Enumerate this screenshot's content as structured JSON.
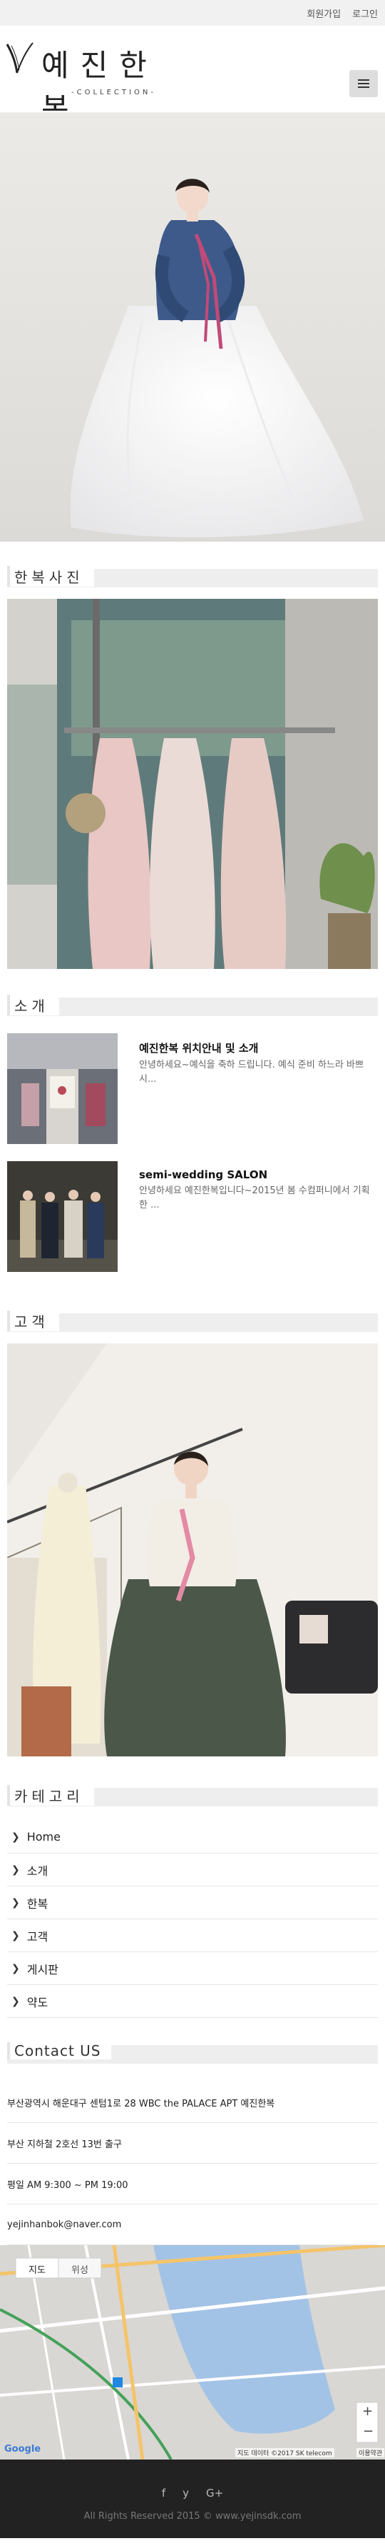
{
  "topbar": {
    "signup": "회원가입",
    "login": "로그인"
  },
  "logo": {
    "title": "예진한복",
    "subtitle": "-COLLECTION-"
  },
  "sections": {
    "photos": "한복사진",
    "intro": "소개",
    "customers": "고객",
    "category": "카테고리",
    "contact": "Contact US"
  },
  "news": [
    {
      "title": "예진한복 위치안내 및 소개",
      "summary": "안녕하세요~예식을 축하 드립니다. 예식 준비 하느라 바쁘시..."
    },
    {
      "title": "semi-wedding SALON",
      "summary": "안녕하세요 예진한복입니다~2015년 봄 수컴퍼니에서 기획한 ..."
    }
  ],
  "categories": [
    "Home",
    "소개",
    "한복",
    "고객",
    "게시판",
    "약도"
  ],
  "contact": {
    "address": "부산광역시 해운대구 센텀1로 28 WBC the PALACE APT 예진한복",
    "subway": "부산 지하철 2호선 13번 출구",
    "hours": "평일 AM 9:300 ~ PM 19:00",
    "email": "yejinhanbok@naver.com"
  },
  "map": {
    "labels": [
      "지도",
      "위성",
      "Google",
      "지도 데이터 ©2017 SK telecom",
      "이용약관"
    ],
    "zoom_in": "+",
    "zoom_out": "−"
  },
  "footer": {
    "social": [
      "f",
      "y",
      "G+"
    ],
    "copyright": "All Rights Reserved 2015 © www.yejinsdk.com"
  }
}
